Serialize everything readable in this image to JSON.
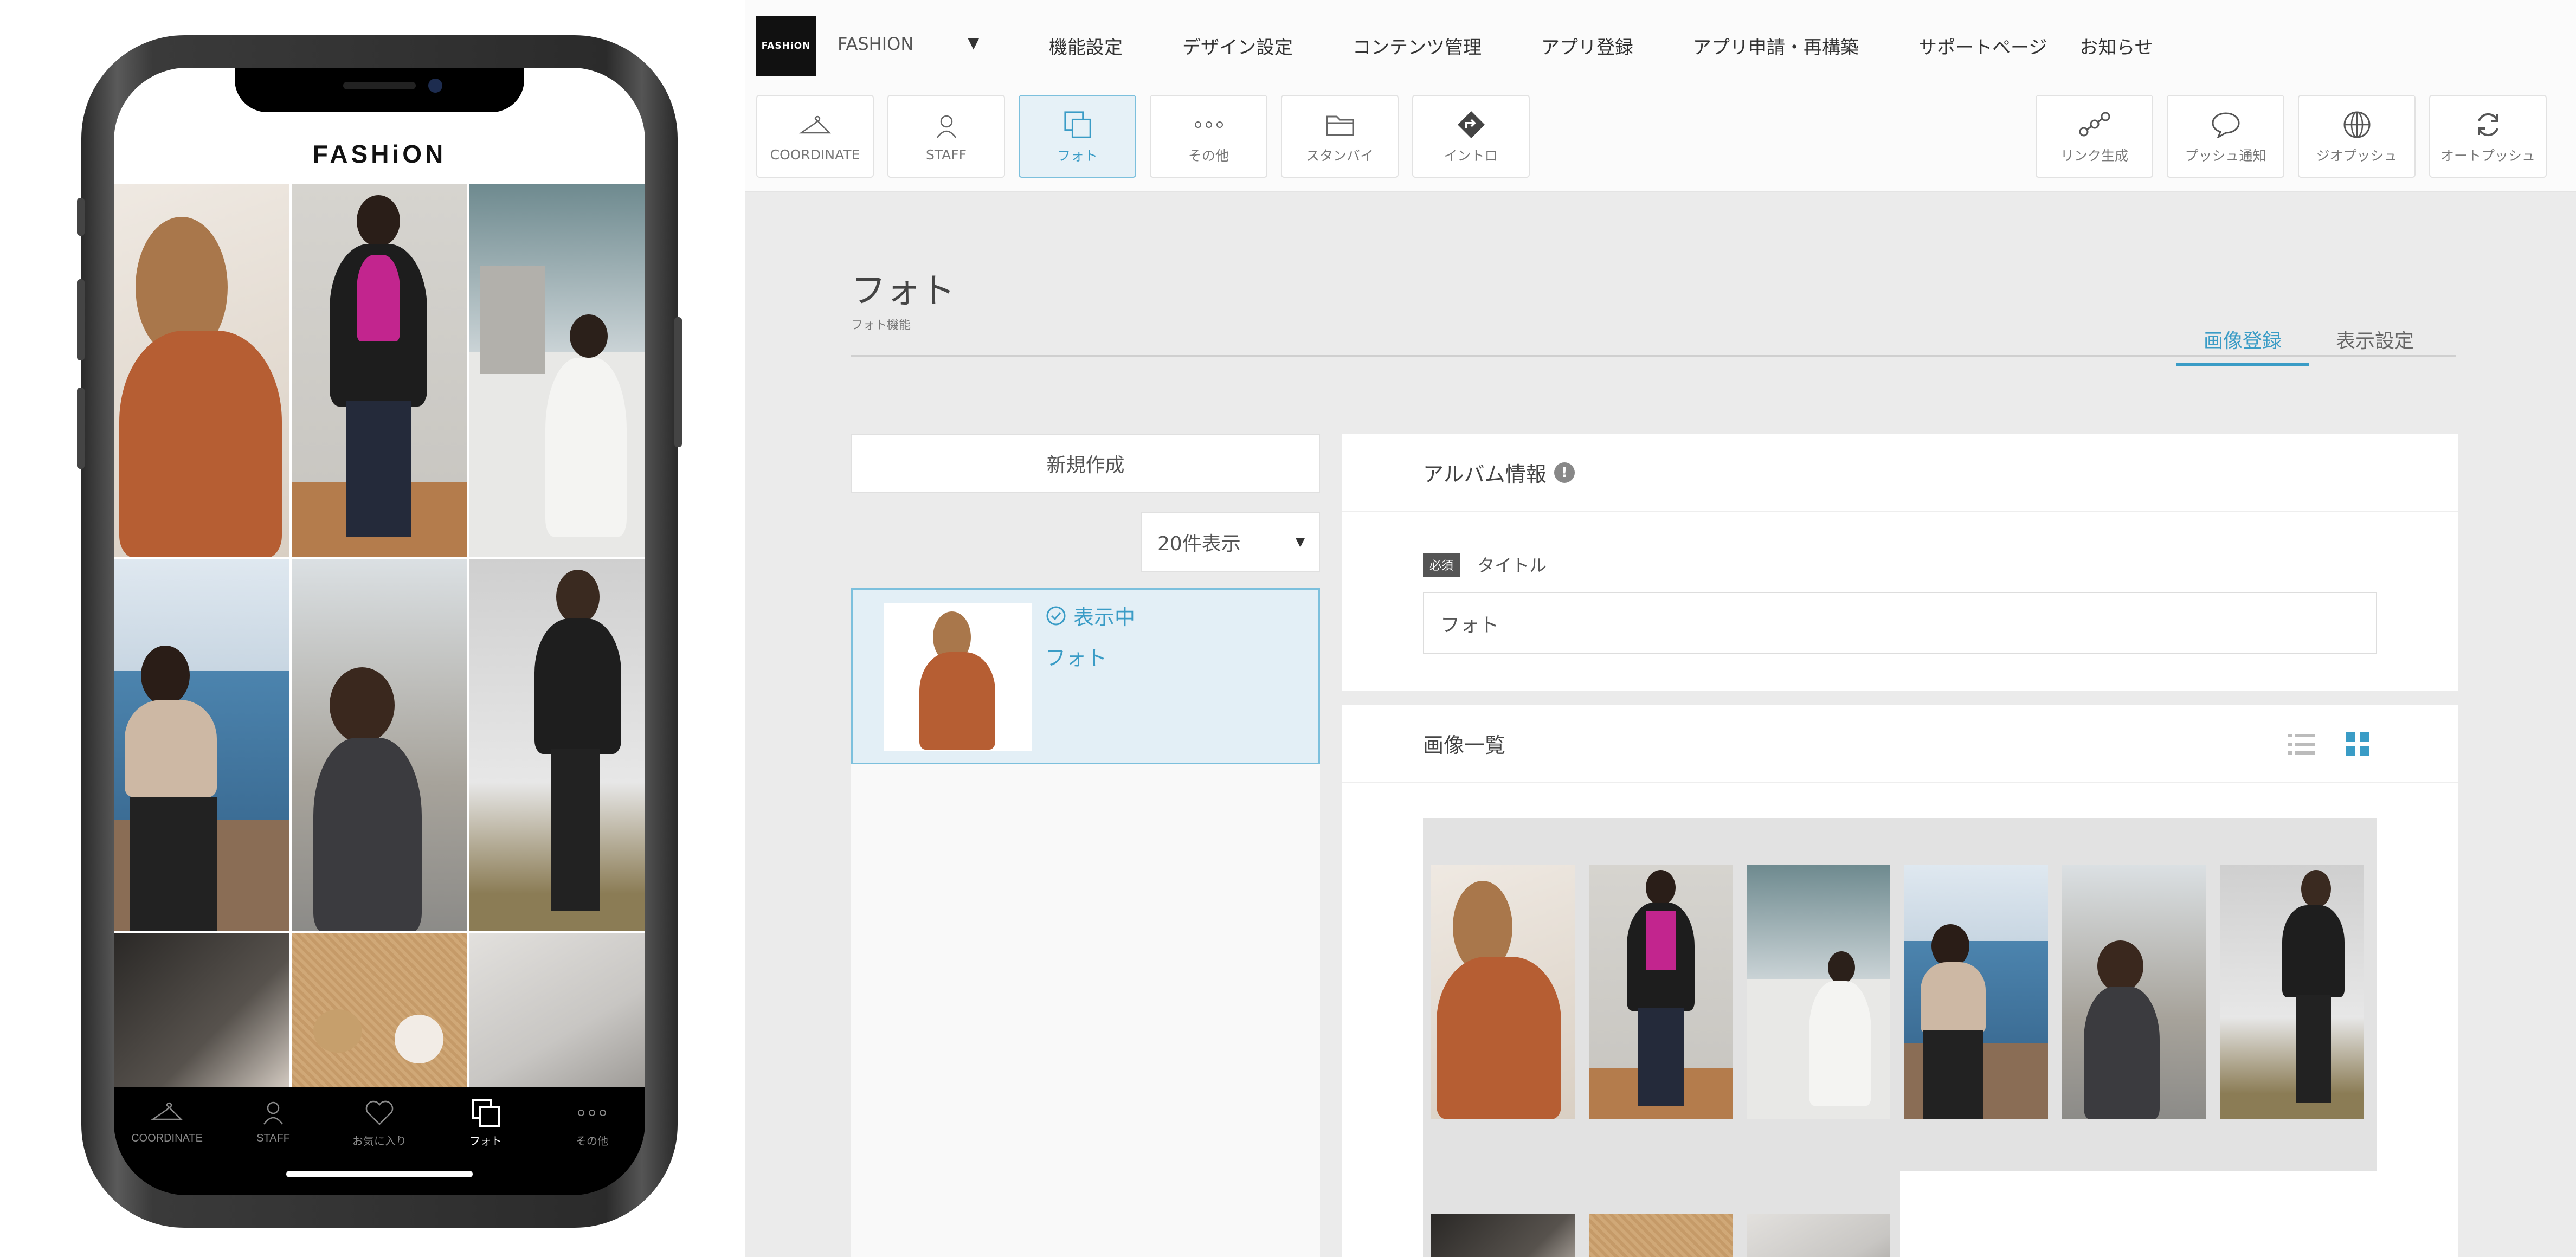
{
  "phone": {
    "logo": "FASHiON",
    "tabs": [
      {
        "label": "COORDINATE",
        "icon": "hanger-icon"
      },
      {
        "label": "STAFF",
        "icon": "person-icon"
      },
      {
        "label": "お気に入り",
        "icon": "heart-icon"
      },
      {
        "label": "フォト",
        "icon": "photos-icon"
      },
      {
        "label": "その他",
        "icon": "more-dots-icon"
      }
    ],
    "active_tab": "フォト"
  },
  "admin": {
    "brand_logo": "FASHiON",
    "brand_select": "FASHION",
    "nav": [
      "機能設定",
      "デザイン設定",
      "コンテンツ管理",
      "アプリ登録",
      "アプリ申請・再構築",
      "サポートページ",
      "お知らせ"
    ],
    "tools_left": [
      {
        "label": "COORDINATE",
        "icon": "hanger-icon"
      },
      {
        "label": "STAFF",
        "icon": "person-icon"
      },
      {
        "label": "フォト",
        "icon": "photos-icon"
      },
      {
        "label": "その他",
        "icon": "more-dots-icon"
      },
      {
        "label": "スタンバイ",
        "icon": "folder-icon"
      },
      {
        "label": "イントロ",
        "icon": "diamond-arrow-icon"
      }
    ],
    "tools_right": [
      {
        "label": "リンク生成",
        "icon": "link-icon"
      },
      {
        "label": "プッシュ通知",
        "icon": "speech-bubble-icon"
      },
      {
        "label": "ジオプッシュ",
        "icon": "globe-icon"
      },
      {
        "label": "オートプッシュ",
        "icon": "refresh-icon"
      }
    ],
    "active_tool": "フォト"
  },
  "page": {
    "title": "フォト",
    "subtitle": "フォト機能",
    "tabs": [
      "画像登録",
      "表示設定"
    ],
    "active_tab": "画像登録",
    "new_button": "新規作成",
    "per_page": "20件表示",
    "album": {
      "status": "表示中",
      "name": "フォト"
    },
    "album_info": {
      "heading": "アルバム情報",
      "info_icon": "!",
      "required_badge": "必須",
      "title_label": "タイトル",
      "title_value": "フォト"
    },
    "images": {
      "heading": "画像一覧"
    }
  },
  "colors": {
    "accent": "#3a9cc6",
    "active_bg": "#e6f1f7",
    "page_bg": "#ebebeb"
  }
}
